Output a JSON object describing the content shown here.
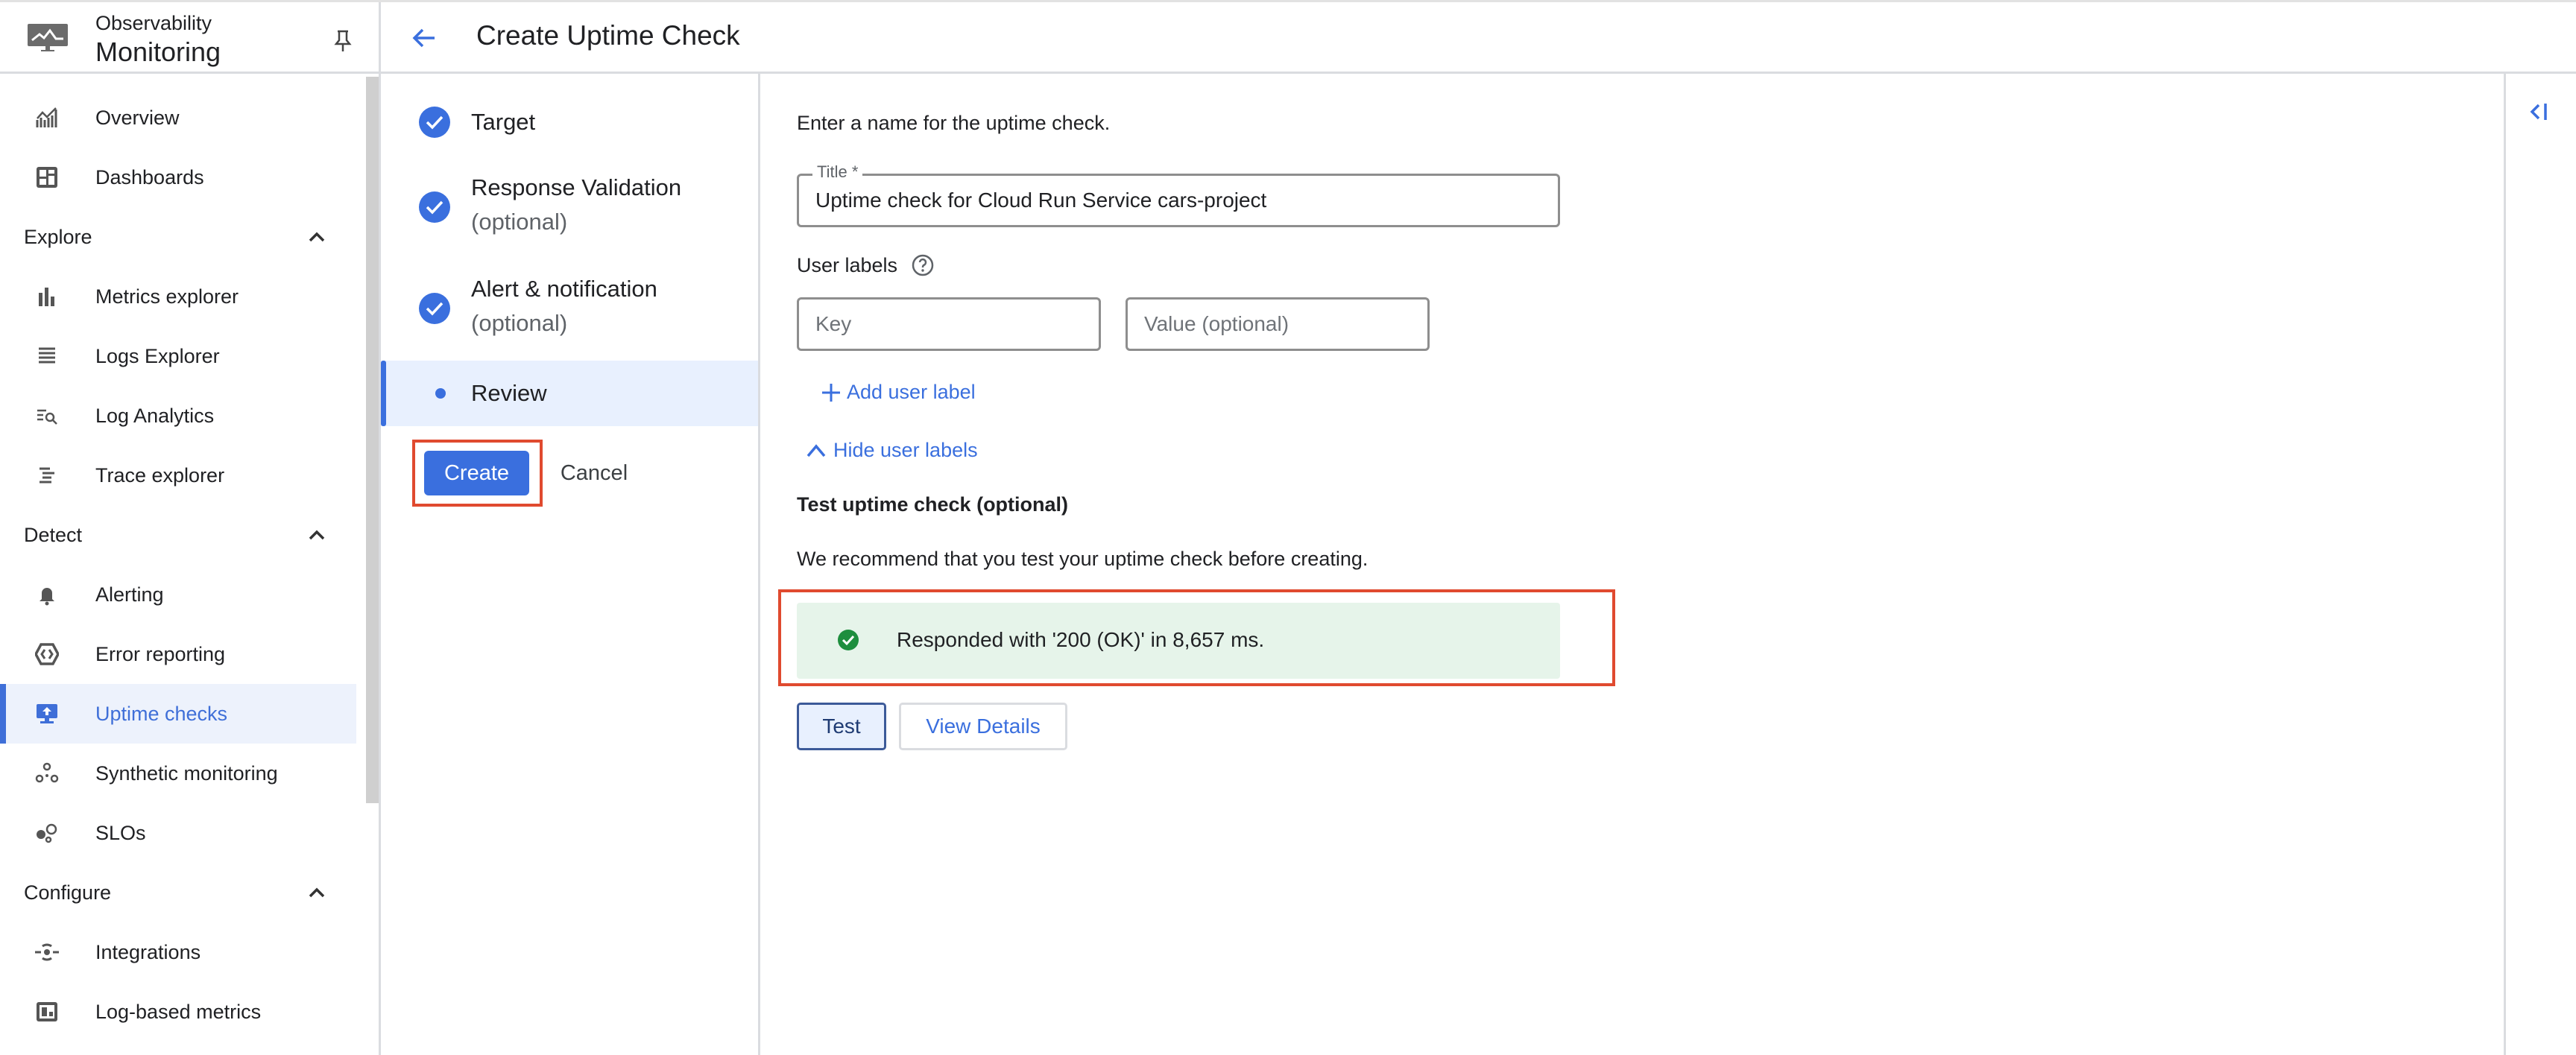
{
  "product": {
    "supertitle": "Observability",
    "name": "Monitoring"
  },
  "header": {
    "title": "Create Uptime Check"
  },
  "sidebar": {
    "top_items": [
      {
        "label": "Overview",
        "icon": "overview-chart-icon"
      },
      {
        "label": "Dashboards",
        "icon": "dashboard-icon"
      }
    ],
    "sections": [
      {
        "label": "Explore",
        "expanded": true,
        "items": [
          {
            "label": "Metrics explorer",
            "icon": "bar-chart-icon"
          },
          {
            "label": "Logs Explorer",
            "icon": "list-icon"
          },
          {
            "label": "Log Analytics",
            "icon": "log-search-icon"
          },
          {
            "label": "Trace explorer",
            "icon": "trace-icon"
          }
        ]
      },
      {
        "label": "Detect",
        "expanded": true,
        "items": [
          {
            "label": "Alerting",
            "icon": "bell-icon"
          },
          {
            "label": "Error reporting",
            "icon": "error-reporting-icon"
          },
          {
            "label": "Uptime checks",
            "icon": "uptime-monitor-icon",
            "active": true
          },
          {
            "label": "Synthetic monitoring",
            "icon": "synthetic-icon"
          },
          {
            "label": "SLOs",
            "icon": "slo-icon"
          }
        ]
      },
      {
        "label": "Configure",
        "expanded": true,
        "items": [
          {
            "label": "Integrations",
            "icon": "integrations-icon"
          },
          {
            "label": "Log-based metrics",
            "icon": "log-metrics-icon"
          }
        ]
      }
    ]
  },
  "stepper": {
    "steps": [
      {
        "label": "Target",
        "optional": "",
        "status": "complete"
      },
      {
        "label": "Response Validation",
        "optional": "(optional)",
        "status": "complete"
      },
      {
        "label": "Alert & notification",
        "optional": "(optional)",
        "status": "complete"
      },
      {
        "label": "Review",
        "optional": "",
        "status": "current"
      }
    ],
    "create_label": "Create",
    "cancel_label": "Cancel"
  },
  "form": {
    "intro": "Enter a name for the uptime check.",
    "title_label": "Title *",
    "title_value": "Uptime check for Cloud Run Service cars-project",
    "user_labels_heading": "User labels",
    "key_placeholder": "Key",
    "value_placeholder": "Value (optional)",
    "add_label": "Add user label",
    "hide_labels": "Hide user labels",
    "test_heading": "Test uptime check (optional)",
    "test_recommend": "We recommend that you test your uptime check before creating.",
    "test_result": "Responded with '200 (OK)' in 8,657 ms.",
    "test_button": "Test",
    "view_details_button": "View Details"
  },
  "colors": {
    "accent": "#3a6fde",
    "highlight": "#e04a2f",
    "success_bg": "#e6f4ea",
    "success": "#1e8e3e"
  }
}
